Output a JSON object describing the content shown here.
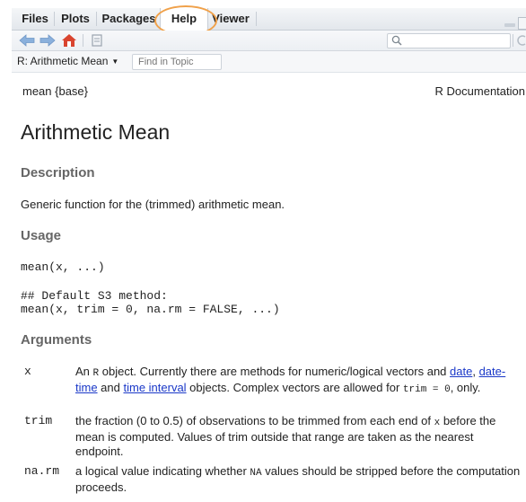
{
  "tabs": [
    "Files",
    "Plots",
    "Packages",
    "Help",
    "Viewer"
  ],
  "active_tab": "Help",
  "search": {
    "placeholder": ""
  },
  "topic": {
    "label": "R: Arithmetic Mean",
    "find_placeholder": "Find in Topic"
  },
  "doc": {
    "header_left": "mean {base}",
    "header_right": "R Documentation",
    "title": "Arithmetic Mean",
    "description_heading": "Description",
    "description_text": "Generic function for the (trimmed) arithmetic mean.",
    "usage_heading": "Usage",
    "usage_code_1": "mean(x, ...)",
    "usage_code_2": "## Default S3 method:\nmean(x, trim = 0, na.rm = FALSE, ...)",
    "arguments_heading": "Arguments",
    "args": {
      "x": {
        "name": "x",
        "t1": "An ",
        "c1": "R",
        "t2": " object. Currently there are methods for numeric/logical vectors and ",
        "l1": "date",
        "t3": ", ",
        "l2": "date-time",
        "t4": " and ",
        "l3": "time interval",
        "t5": " objects. Complex vectors are allowed for ",
        "c2": "trim = 0",
        "t6": ", only."
      },
      "trim": {
        "name": "trim",
        "t1": "the fraction (0 to 0.5) of observations to be trimmed from each end of ",
        "c1": "x",
        "t2": " before the mean is computed. Values of trim outside that range are taken as the nearest endpoint."
      },
      "narm": {
        "name": "na.rm",
        "t1": "a logical value indicating whether ",
        "c1": "NA",
        "t2": " values should be stripped before the computation proceeds."
      }
    }
  },
  "colors": {
    "link": "#1a38c8",
    "highlight_ring": "#f0a14a",
    "heading": "#666666"
  },
  "icons": [
    "back-arrow-icon",
    "forward-arrow-icon",
    "home-icon",
    "print-icon",
    "search-icon",
    "refresh-icon",
    "minimize-icon",
    "maximize-icon"
  ]
}
